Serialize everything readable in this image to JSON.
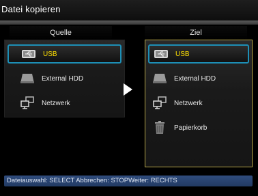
{
  "window": {
    "title": "Datei kopieren"
  },
  "source": {
    "heading": "Quelle",
    "items": [
      {
        "label": "USB",
        "icon": "usb-icon",
        "selected": true
      },
      {
        "label": "External HDD",
        "icon": "hdd-icon",
        "selected": false
      },
      {
        "label": "Netzwerk",
        "icon": "network-icon",
        "selected": false
      }
    ]
  },
  "target": {
    "heading": "Ziel",
    "items": [
      {
        "label": "USB",
        "icon": "usb-icon",
        "selected": true
      },
      {
        "label": "External HDD",
        "icon": "hdd-icon",
        "selected": false
      },
      {
        "label": "Netzwerk",
        "icon": "network-icon",
        "selected": false
      },
      {
        "label": "Papierkorb",
        "icon": "trash-icon",
        "selected": false
      }
    ]
  },
  "status": {
    "text": "Dateiauswahl: SELECT Abbrechen: STOPWeiter: RECHTS"
  },
  "colors": {
    "selection_border": "#1d8fb6",
    "selection_text": "#ffe000",
    "target_panel_border": "#b9a94a",
    "status_bar": "#2f4c7d"
  }
}
